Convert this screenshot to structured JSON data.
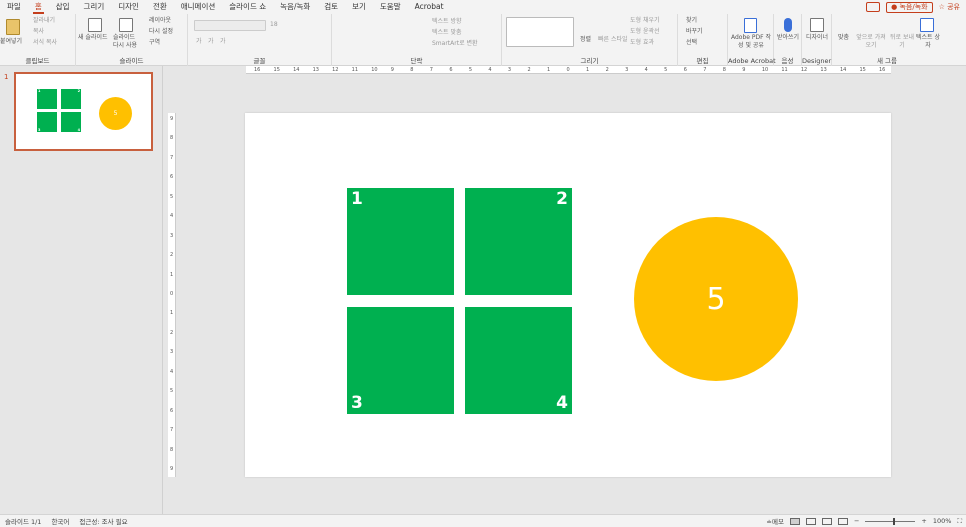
{
  "menu": {
    "tabs": [
      "파일",
      "홈",
      "삽입",
      "그리기",
      "디자인",
      "전환",
      "애니메이션",
      "슬라이드 쇼",
      "녹음/녹화",
      "검토",
      "보기",
      "도움말",
      "Acrobat"
    ],
    "active_tab": "홈",
    "record_label": "● 녹음/녹화",
    "share_label": "☆ 공유"
  },
  "ribbon": {
    "clipboard": {
      "label": "클립보드",
      "paste": "붙여넣기",
      "cut": "잘라내기",
      "copy": "복사",
      "format_painter": "서식 복사"
    },
    "slides": {
      "label": "슬라이드",
      "new_slide": "새 슬라이드",
      "reuse": "슬라이드 다시 사용",
      "layout": "레이아웃",
      "reset": "다시 설정",
      "section": "구역"
    },
    "font": {
      "label": "글꼴",
      "font_size": "18",
      "bold": "가",
      "italic": "가",
      "underline": "가"
    },
    "paragraph": {
      "label": "단락",
      "text_direction": "텍스트 방향",
      "align_text": "텍스트 맞춤",
      "smartart": "SmartArt로 변환"
    },
    "drawing": {
      "label": "그리기",
      "arrange": "정렬",
      "quick_styles": "빠른 스타일",
      "shape_fill": "도형 채우기",
      "shape_outline": "도형 윤곽선",
      "shape_effects": "도형 효과"
    },
    "editing": {
      "label": "편집",
      "find": "찾기",
      "replace": "바꾸기",
      "select": "선택"
    },
    "acrobat": {
      "label": "Adobe Acrobat",
      "create": "Adobe PDF 작성 및 공유"
    },
    "voice": {
      "label": "음성",
      "dictate": "받아쓰기"
    },
    "designer": {
      "label": "Designer",
      "ideas": "디자이너"
    },
    "new_group": {
      "label": "새 그룹",
      "align": "맞춤",
      "bring_forward": "앞으로 가져오기",
      "send_backward": "뒤로 보내기",
      "text_box": "텍스트 상자"
    }
  },
  "ruler": {
    "h_labels": [
      "16",
      "15",
      "14",
      "13",
      "12",
      "11",
      "10",
      "9",
      "8",
      "7",
      "6",
      "5",
      "4",
      "3",
      "2",
      "1",
      "0",
      "1",
      "2",
      "3",
      "4",
      "5",
      "6",
      "7",
      "8",
      "9",
      "10",
      "11",
      "12",
      "13",
      "14",
      "15",
      "16"
    ],
    "v_labels": [
      "9",
      "8",
      "7",
      "6",
      "5",
      "4",
      "3",
      "2",
      "1",
      "0",
      "1",
      "2",
      "3",
      "4",
      "5",
      "6",
      "7",
      "8",
      "9"
    ]
  },
  "thumbnails": {
    "slide_number": "1",
    "square_labels": [
      "1",
      "2",
      "3",
      "4"
    ],
    "circle_label": "5"
  },
  "slide": {
    "squares": [
      {
        "label": "1"
      },
      {
        "label": "2"
      },
      {
        "label": "3"
      },
      {
        "label": "4"
      }
    ],
    "circle": {
      "label": "5"
    },
    "colors": {
      "square": "#00b050",
      "circle": "#ffc000",
      "accent": "#c43e1c"
    }
  },
  "status": {
    "slide_count": "슬라이드 1/1",
    "language": "한국어",
    "accessibility": "접근성: 조사 필요",
    "notes": "≐메모",
    "zoom": "100%"
  }
}
